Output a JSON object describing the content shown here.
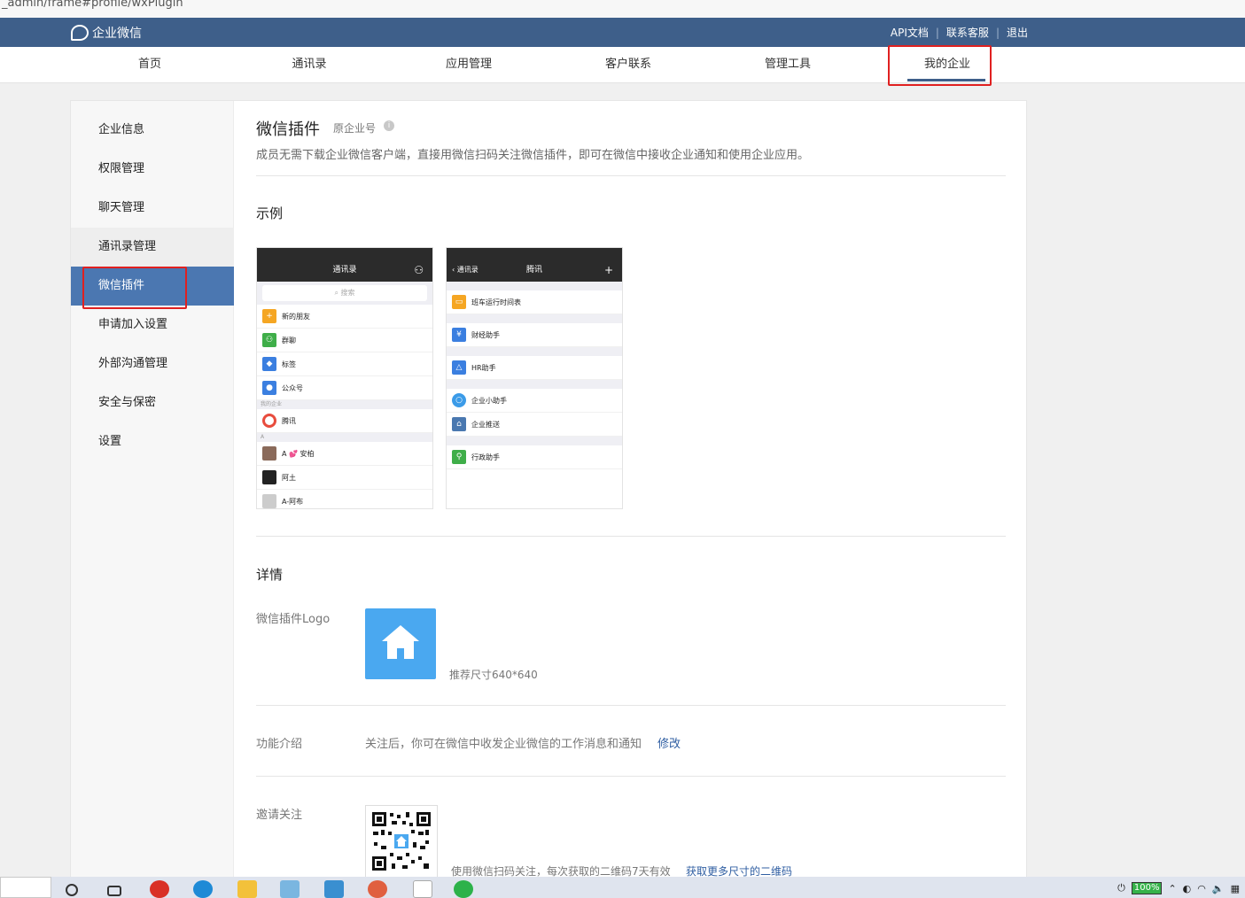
{
  "browser": {
    "url_fragment": "_admin/frame#profile/wxPlugin"
  },
  "header": {
    "brand": "企业微信",
    "links": [
      "API文档",
      "联系客服",
      "退出"
    ]
  },
  "nav": {
    "items": [
      "首页",
      "通讯录",
      "应用管理",
      "客户联系",
      "管理工具",
      "我的企业"
    ],
    "active_index": 5
  },
  "sidebar": {
    "items": [
      "企业信息",
      "权限管理",
      "聊天管理",
      "通讯录管理",
      "微信插件",
      "申请加入设置",
      "外部沟通管理",
      "安全与保密",
      "设置"
    ],
    "active_index": 4
  },
  "page": {
    "title": "微信插件",
    "subtitle": "原企业号",
    "description": "成员无需下载企业微信客户端，直接用微信扫码关注微信插件，即可在微信中接收企业通知和使用企业应用。",
    "example_title": "示例",
    "details_title": "详情"
  },
  "phone1": {
    "title": "通讯录",
    "search": "搜索",
    "rows": [
      {
        "label": "新的朋友",
        "color": "#f5a623"
      },
      {
        "label": "群聊",
        "color": "#3fae49"
      },
      {
        "label": "标签",
        "color": "#3b7fe0"
      },
      {
        "label": "公众号",
        "color": "#3b7fe0"
      }
    ],
    "group1": "我的企业",
    "enterprise": "腾讯",
    "group2": "A",
    "contacts": [
      "A 💕 安柏",
      "阿土",
      "A-阿布"
    ]
  },
  "phone2": {
    "back": "通讯录",
    "title": "腾讯",
    "rows": [
      {
        "label": "班车运行时间表",
        "color": "#f5a623"
      },
      {
        "label": "财经助手",
        "color": "#3b7fe0"
      },
      {
        "label": "HR助手",
        "color": "#3b7fe0"
      },
      {
        "label": "企业小助手",
        "color": "#3b9be8"
      },
      {
        "label": "企业推送",
        "color": "#4a78b0"
      },
      {
        "label": "行政助手",
        "color": "#3fae49"
      }
    ]
  },
  "details": {
    "logo_label": "微信插件Logo",
    "logo_hint": "推荐尺寸640*640",
    "intro_label": "功能介绍",
    "intro_value": "关注后，你可在微信中收发企业微信的工作消息和通知",
    "intro_edit": "修改",
    "invite_label": "邀请关注",
    "invite_hint": "使用微信扫码关注，每次获取的二维码7天有效",
    "invite_link": "获取更多尺寸的二维码"
  },
  "taskbar": {
    "battery": "100%"
  },
  "colors": {
    "header": "#3e5f8a",
    "active": "#4b77b1",
    "highlight": "#e02020",
    "logo_bg": "#4aa8f0"
  }
}
